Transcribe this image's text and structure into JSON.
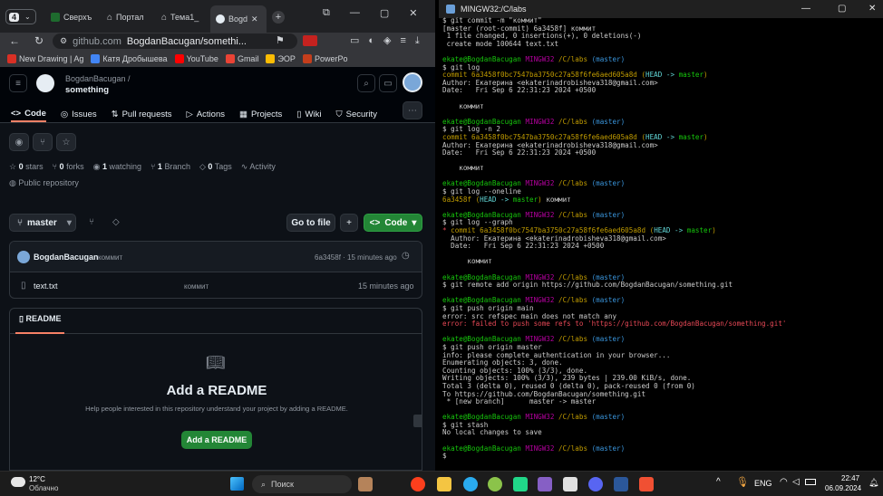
{
  "browser": {
    "tab_count": "4",
    "tabs": [
      "Сверхъ",
      "Портал",
      "Тема1_",
      "Bogd"
    ],
    "url_domain": "github.com",
    "url_path": "BogdanBacugan/somethi...",
    "bookmarks": [
      "New Drawing | Ag",
      "Катя Дробышева",
      "YouTube",
      "Gmail",
      "ЭОР",
      "PowerPo"
    ]
  },
  "github": {
    "owner": "BogdanBacugan /",
    "repo": "something",
    "nav": [
      "Code",
      "Issues",
      "Pull requests",
      "Actions",
      "Projects",
      "Wiki",
      "Security"
    ],
    "stats": {
      "stars": "0",
      "stars_label": "stars",
      "forks": "0",
      "forks_label": "forks",
      "watching": "1",
      "watching_label": "watching",
      "branch": "1",
      "branch_label": "Branch",
      "tags": "0",
      "tags_label": "Tags",
      "activity": "Activity"
    },
    "visibility": "Public repository",
    "branch": "master",
    "goto_file": "Go to file",
    "code_button": "Code",
    "commit": {
      "author": "BogdanBacugan",
      "message": "коммит",
      "hash_time": "6a3458f · 15 minutes ago"
    },
    "file": {
      "name": "text.txt",
      "message": "коммит",
      "time": "15 minutes ago"
    },
    "readme_tab": "README",
    "readme_title": "Add a README",
    "readme_desc": "Help people interested in this repository understand your project by adding a README.",
    "readme_button": "Add a README"
  },
  "terminal": {
    "title": "MINGW32:/C/labs",
    "lines": [
      [
        [
          "$ git commit -m \"коммит\"",
          ""
        ]
      ],
      [
        [
          "[master (root-commit) 6a3458f] коммит",
          ""
        ]
      ],
      [
        [
          " 1 file changed, 0 insertions(+), 0 deletions(-)",
          ""
        ]
      ],
      [
        [
          " create mode 100644 text.txt",
          ""
        ]
      ],
      [
        [
          "",
          ""
        ]
      ],
      [
        [
          "ekate@BogdanBacugan ",
          "g"
        ],
        [
          "MINGW32 ",
          "m"
        ],
        [
          "/C/labs ",
          "y"
        ],
        [
          "(master)",
          "c"
        ]
      ],
      [
        [
          "$ git log",
          ""
        ]
      ],
      [
        [
          "commit 6a3458f0bc7547ba3750c27a58f6fe6aed605a8d ",
          "y"
        ],
        [
          "(",
          "y"
        ],
        [
          "HEAD -> ",
          "cy"
        ],
        [
          "master",
          "g"
        ],
        [
          ")",
          "y"
        ]
      ],
      [
        [
          "Author: Екатерина <ekaterinadrobisheva318@gmail.com>",
          ""
        ]
      ],
      [
        [
          "Date:   Fri Sep 6 22:31:23 2024 +0500",
          ""
        ]
      ],
      [
        [
          "",
          ""
        ]
      ],
      [
        [
          "    коммит",
          ""
        ]
      ],
      [
        [
          "",
          ""
        ]
      ],
      [
        [
          "ekate@BogdanBacugan ",
          "g"
        ],
        [
          "MINGW32 ",
          "m"
        ],
        [
          "/C/labs ",
          "y"
        ],
        [
          "(master)",
          "c"
        ]
      ],
      [
        [
          "$ git log -n 2",
          ""
        ]
      ],
      [
        [
          "commit 6a3458f0bc7547ba3750c27a58f6fe6aed605a8d ",
          "y"
        ],
        [
          "(",
          "y"
        ],
        [
          "HEAD -> ",
          "cy"
        ],
        [
          "master",
          "g"
        ],
        [
          ")",
          "y"
        ]
      ],
      [
        [
          "Author: Екатерина <ekaterinadrobisheva318@gmail.com>",
          ""
        ]
      ],
      [
        [
          "Date:   Fri Sep 6 22:31:23 2024 +0500",
          ""
        ]
      ],
      [
        [
          "",
          ""
        ]
      ],
      [
        [
          "    коммит",
          ""
        ]
      ],
      [
        [
          "",
          ""
        ]
      ],
      [
        [
          "ekate@BogdanBacugan ",
          "g"
        ],
        [
          "MINGW32 ",
          "m"
        ],
        [
          "/C/labs ",
          "y"
        ],
        [
          "(master)",
          "c"
        ]
      ],
      [
        [
          "$ git log --oneline",
          ""
        ]
      ],
      [
        [
          "6a3458f ",
          "y"
        ],
        [
          "(",
          "y"
        ],
        [
          "HEAD -> ",
          "cy"
        ],
        [
          "master",
          "g"
        ],
        [
          ") ",
          "y"
        ],
        [
          "коммит",
          ""
        ]
      ],
      [
        [
          "",
          ""
        ]
      ],
      [
        [
          "ekate@BogdanBacugan ",
          "g"
        ],
        [
          "MINGW32 ",
          "m"
        ],
        [
          "/C/labs ",
          "y"
        ],
        [
          "(master)",
          "c"
        ]
      ],
      [
        [
          "$ git log --graph",
          ""
        ]
      ],
      [
        [
          "* ",
          "r"
        ],
        [
          "commit 6a3458f0bc7547ba3750c27a58f6fe6aed605a8d ",
          "y"
        ],
        [
          "(",
          "y"
        ],
        [
          "HEAD -> ",
          "cy"
        ],
        [
          "master",
          "g"
        ],
        [
          ")",
          "y"
        ]
      ],
      [
        [
          "  Author: Екатерина <ekaterinadrobisheva318@gmail.com>",
          ""
        ]
      ],
      [
        [
          "  Date:   Fri Sep 6 22:31:23 2024 +0500",
          ""
        ]
      ],
      [
        [
          "",
          ""
        ]
      ],
      [
        [
          "      коммит",
          ""
        ]
      ],
      [
        [
          "",
          ""
        ]
      ],
      [
        [
          "ekate@BogdanBacugan ",
          "g"
        ],
        [
          "MINGW32 ",
          "m"
        ],
        [
          "/C/labs ",
          "y"
        ],
        [
          "(master)",
          "c"
        ]
      ],
      [
        [
          "$ git remote add origin https://github.com/BogdanBacugan/something.git",
          ""
        ]
      ],
      [
        [
          "",
          ""
        ]
      ],
      [
        [
          "ekate@BogdanBacugan ",
          "g"
        ],
        [
          "MINGW32 ",
          "m"
        ],
        [
          "/C/labs ",
          "y"
        ],
        [
          "(master)",
          "c"
        ]
      ],
      [
        [
          "$ git push origin main",
          ""
        ]
      ],
      [
        [
          "error: src refspec main does not match any",
          ""
        ]
      ],
      [
        [
          "error: failed to push some refs to 'https://github.com/BogdanBacugan/something.git'",
          "r"
        ]
      ],
      [
        [
          "",
          ""
        ]
      ],
      [
        [
          "ekate@BogdanBacugan ",
          "g"
        ],
        [
          "MINGW32 ",
          "m"
        ],
        [
          "/C/labs ",
          "y"
        ],
        [
          "(master)",
          "c"
        ]
      ],
      [
        [
          "$ git push origin master",
          ""
        ]
      ],
      [
        [
          "info: please complete authentication in your browser...",
          ""
        ]
      ],
      [
        [
          "Enumerating objects: 3, done.",
          ""
        ]
      ],
      [
        [
          "Counting objects: 100% (3/3), done.",
          ""
        ]
      ],
      [
        [
          "Writing objects: 100% (3/3), 239 bytes | 239.00 KiB/s, done.",
          ""
        ]
      ],
      [
        [
          "Total 3 (delta 0), reused 0 (delta 0), pack-reused 0 (from 0)",
          ""
        ]
      ],
      [
        [
          "To https://github.com/BogdanBacugan/something.git",
          ""
        ]
      ],
      [
        [
          " * [new branch]      master -> master",
          ""
        ]
      ],
      [
        [
          "",
          ""
        ]
      ],
      [
        [
          "ekate@BogdanBacugan ",
          "g"
        ],
        [
          "MINGW32 ",
          "m"
        ],
        [
          "/C/labs ",
          "y"
        ],
        [
          "(master)",
          "c"
        ]
      ],
      [
        [
          "$ git stash",
          ""
        ]
      ],
      [
        [
          "No local changes to save",
          ""
        ]
      ],
      [
        [
          "",
          ""
        ]
      ],
      [
        [
          "ekate@BogdanBacugan ",
          "g"
        ],
        [
          "MINGW32 ",
          "m"
        ],
        [
          "/C/labs ",
          "y"
        ],
        [
          "(master)",
          "c"
        ]
      ],
      [
        [
          "$ ",
          ""
        ]
      ]
    ]
  },
  "taskbar": {
    "temp": "12°C",
    "weather": "Облачно",
    "search": "Поиск",
    "lang": "ENG",
    "time": "22:47",
    "date": "06.09.2024"
  }
}
